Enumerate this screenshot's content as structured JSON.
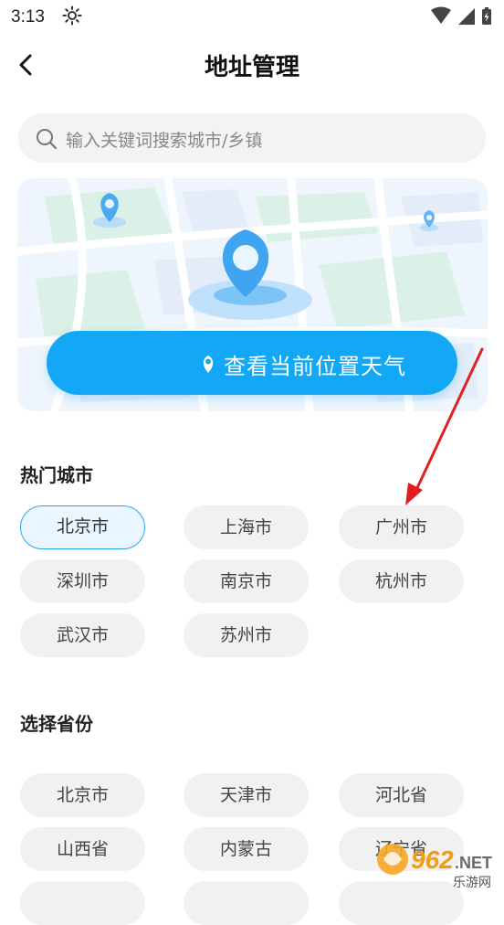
{
  "status_bar": {
    "time": "3:13",
    "weather_icon": "sun-icon"
  },
  "header": {
    "title": "地址管理",
    "back_icon": "chevron-left-icon"
  },
  "search": {
    "placeholder": "输入关键词搜索城市/乡镇",
    "icon": "search-icon"
  },
  "location": {
    "button_label": "查看当前位置天气",
    "icon": "location-pin-icon"
  },
  "hot_cities": {
    "title": "热门城市",
    "selected": "北京市",
    "items": [
      "北京市",
      "上海市",
      "广州市",
      "深圳市",
      "南京市",
      "杭州市",
      "武汉市",
      "苏州市"
    ]
  },
  "provinces": {
    "title": "选择省份",
    "items": [
      "北京市",
      "天津市",
      "河北省",
      "山西省",
      "内蒙古",
      "辽宁省"
    ]
  },
  "watermark": {
    "number": "962",
    "suffix": ".NET",
    "sub": "乐游网"
  },
  "colors": {
    "accent": "#12a8f5",
    "chip_bg": "#f1f1f1",
    "active_chip_bg": "#e9f6ff",
    "annotation_arrow": "#e02020"
  }
}
